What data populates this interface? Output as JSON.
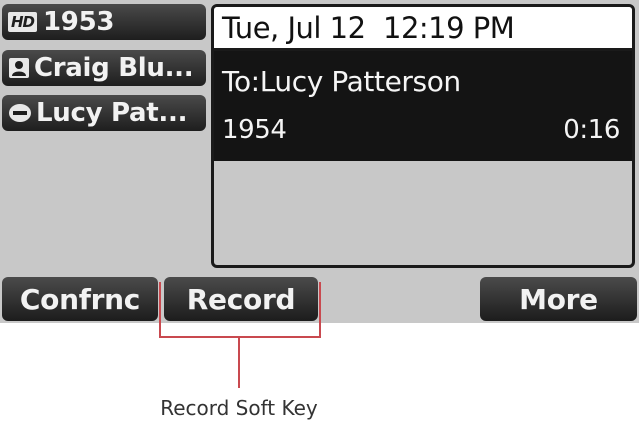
{
  "lines": [
    {
      "badge": "HD",
      "label": "1953",
      "icon": "hd-badge-icon"
    },
    {
      "label": "Craig Blu...",
      "icon": "person-icon"
    },
    {
      "label": "Lucy Pat...",
      "icon": "active-call-icon"
    }
  ],
  "header": {
    "datetime": "Tue, Jul 12  12:19 PM"
  },
  "call": {
    "to": "To:Lucy Patterson",
    "number": "1954",
    "duration": "0:16"
  },
  "softkeys": {
    "confrnc": "Confrnc",
    "record": "Record",
    "more": "More"
  },
  "callout": {
    "label": "Record Soft Key",
    "color": "#c9494f"
  }
}
